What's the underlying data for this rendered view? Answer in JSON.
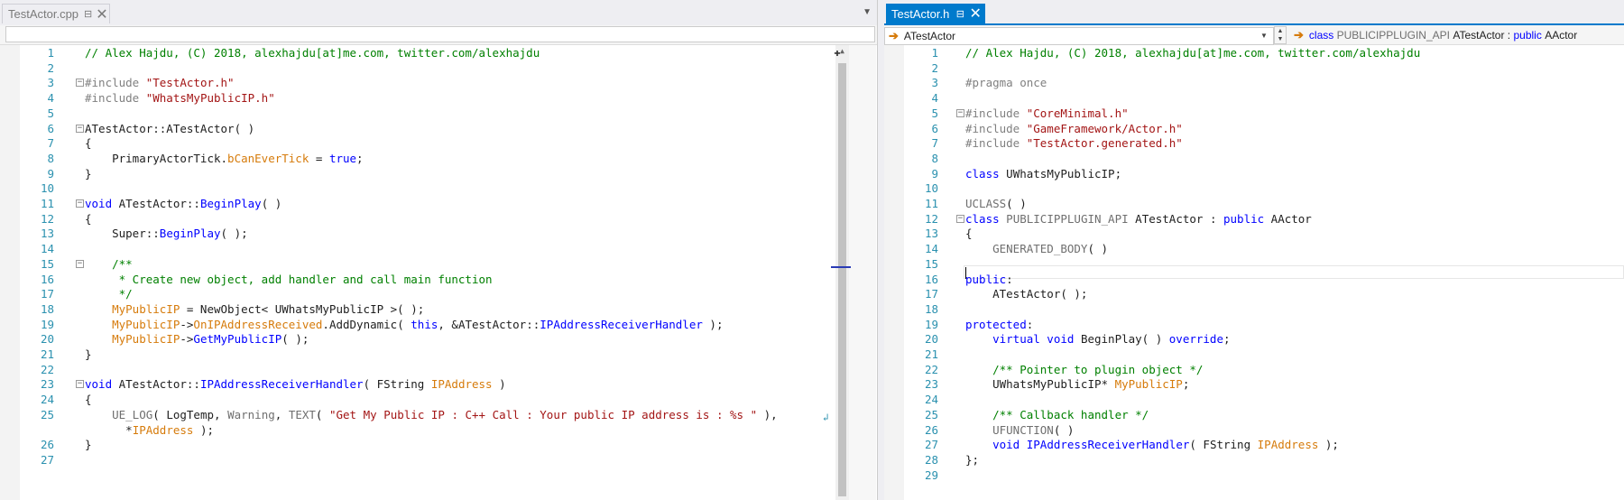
{
  "left_pane": {
    "tab": {
      "label": "TestActor.cpp"
    },
    "nav": {
      "value": ""
    },
    "lines": [
      {
        "n": "1",
        "tokens": [
          [
            "cm",
            "// Alex Hajdu, (C) 2018, alexhajdu[at]me.com, twitter.com/alexhajdu"
          ]
        ]
      },
      {
        "n": "2",
        "tokens": []
      },
      {
        "n": "3",
        "fold": true,
        "tokens": [
          [
            "pp",
            "#include "
          ],
          [
            "st",
            "\"TestActor.h\""
          ]
        ]
      },
      {
        "n": "4",
        "tokens": [
          [
            "pp",
            "#include "
          ],
          [
            "st",
            "\"WhatsMyPublicIP.h\""
          ]
        ]
      },
      {
        "n": "5",
        "tokens": []
      },
      {
        "n": "6",
        "fold": true,
        "tokens": [
          [
            "ty",
            "ATestActor::ATestActor( )"
          ]
        ]
      },
      {
        "n": "7",
        "tokens": [
          [
            "ty",
            "{"
          ]
        ]
      },
      {
        "n": "8",
        "tokens": [
          [
            "ty",
            "    PrimaryActorTick."
          ],
          [
            "mem",
            "bCanEverTick"
          ],
          [
            "ty",
            " = "
          ],
          [
            "kw",
            "true"
          ],
          [
            "ty",
            ";"
          ]
        ]
      },
      {
        "n": "9",
        "tokens": [
          [
            "ty",
            "}"
          ]
        ]
      },
      {
        "n": "10",
        "tokens": []
      },
      {
        "n": "11",
        "fold": true,
        "tokens": [
          [
            "kw",
            "void"
          ],
          [
            "ty",
            " ATestActor::"
          ],
          [
            "fn",
            "BeginPlay"
          ],
          [
            "ty",
            "( )"
          ]
        ]
      },
      {
        "n": "12",
        "tokens": [
          [
            "ty",
            "{"
          ]
        ]
      },
      {
        "n": "13",
        "tokens": [
          [
            "ty",
            "    Super::"
          ],
          [
            "fn",
            "BeginPlay"
          ],
          [
            "ty",
            "( );"
          ]
        ]
      },
      {
        "n": "14",
        "tokens": []
      },
      {
        "n": "15",
        "fold": true,
        "tokens": [
          [
            "cm",
            "    /**"
          ]
        ]
      },
      {
        "n": "16",
        "tokens": [
          [
            "cm",
            "     * Create new object, add handler and call main function"
          ]
        ]
      },
      {
        "n": "17",
        "tokens": [
          [
            "cm",
            "     */"
          ]
        ]
      },
      {
        "n": "18",
        "tokens": [
          [
            "mem",
            "    MyPublicIP"
          ],
          [
            "ty",
            " = NewObject< UWhatsMyPublicIP >( );"
          ]
        ]
      },
      {
        "n": "19",
        "tokens": [
          [
            "mem",
            "    MyPublicIP"
          ],
          [
            "ty",
            "->"
          ],
          [
            "mem",
            "OnIPAddressReceived"
          ],
          [
            "ty",
            ".AddDynamic( "
          ],
          [
            "kw",
            "this"
          ],
          [
            "ty",
            ", &ATestActor::"
          ],
          [
            "fn",
            "IPAddressReceiverHandler"
          ],
          [
            "ty",
            " );"
          ]
        ]
      },
      {
        "n": "20",
        "tokens": [
          [
            "mem",
            "    MyPublicIP"
          ],
          [
            "ty",
            "->"
          ],
          [
            "fn",
            "GetMyPublicIP"
          ],
          [
            "ty",
            "( );"
          ]
        ]
      },
      {
        "n": "21",
        "tokens": [
          [
            "ty",
            "}"
          ]
        ]
      },
      {
        "n": "22",
        "tokens": []
      },
      {
        "n": "23",
        "fold": true,
        "tokens": [
          [
            "kw",
            "void"
          ],
          [
            "ty",
            " ATestActor::"
          ],
          [
            "fn",
            "IPAddressReceiverHandler"
          ],
          [
            "ty",
            "( FString "
          ],
          [
            "par",
            "IPAddress"
          ],
          [
            "ty",
            " )"
          ]
        ]
      },
      {
        "n": "24",
        "tokens": [
          [
            "ty",
            "{"
          ]
        ]
      },
      {
        "n": "25",
        "tokens": [
          [
            "mac",
            "    UE_LOG"
          ],
          [
            "ty",
            "( LogTemp, "
          ],
          [
            "mac",
            "Warning"
          ],
          [
            "ty",
            ", "
          ],
          [
            "mac",
            "TEXT"
          ],
          [
            "ty",
            "( "
          ],
          [
            "st",
            "\"Get My Public IP : C++ Call : Your public IP address is : %s \""
          ],
          [
            "ty",
            " ),"
          ]
        ]
      },
      {
        "n": "",
        "tokens": [
          [
            "ty",
            "      *"
          ],
          [
            "par",
            "IPAddress"
          ],
          [
            "ty",
            " );"
          ]
        ]
      },
      {
        "n": "26",
        "tokens": [
          [
            "ty",
            "}"
          ]
        ]
      },
      {
        "n": "27",
        "tokens": []
      }
    ]
  },
  "right_pane": {
    "tab": {
      "label": "TestActor.h"
    },
    "nav": {
      "scope": "ATestActor",
      "member_prefix": "class",
      "member": "PUBLICIPPLUGIN_API",
      "member_class": "ATestActor",
      "member_sep": " : ",
      "member_kw": "public",
      "member_base": "AActor"
    },
    "lines": [
      {
        "n": "1",
        "tokens": [
          [
            "cm",
            "// Alex Hajdu, (C) 2018, alexhajdu[at]me.com, twitter.com/alexhajdu"
          ]
        ]
      },
      {
        "n": "2",
        "tokens": []
      },
      {
        "n": "3",
        "tokens": [
          [
            "pp",
            "#pragma once"
          ]
        ]
      },
      {
        "n": "4",
        "tokens": []
      },
      {
        "n": "5",
        "fold": true,
        "tokens": [
          [
            "pp",
            "#include "
          ],
          [
            "st",
            "\"CoreMinimal.h\""
          ]
        ]
      },
      {
        "n": "6",
        "tokens": [
          [
            "pp",
            "#include "
          ],
          [
            "st",
            "\"GameFramework/Actor.h\""
          ]
        ]
      },
      {
        "n": "7",
        "tokens": [
          [
            "pp",
            "#include "
          ],
          [
            "st",
            "\"TestActor.generated.h\""
          ]
        ]
      },
      {
        "n": "8",
        "tokens": []
      },
      {
        "n": "9",
        "tokens": [
          [
            "kw",
            "class"
          ],
          [
            "ty",
            " UWhatsMyPublicIP;"
          ]
        ]
      },
      {
        "n": "10",
        "tokens": []
      },
      {
        "n": "11",
        "tokens": [
          [
            "mac",
            "UCLASS"
          ],
          [
            "ty",
            "( )"
          ]
        ]
      },
      {
        "n": "12",
        "fold": true,
        "tokens": [
          [
            "kw",
            "class"
          ],
          [
            "mac",
            " PUBLICIPPLUGIN_API"
          ],
          [
            "ty",
            " ATestActor : "
          ],
          [
            "kw",
            "public"
          ],
          [
            "ty",
            " AActor"
          ]
        ]
      },
      {
        "n": "13",
        "tokens": [
          [
            "ty",
            "{"
          ]
        ]
      },
      {
        "n": "14",
        "tokens": [
          [
            "mac",
            "    GENERATED_BODY"
          ],
          [
            "ty",
            "( )"
          ]
        ]
      },
      {
        "n": "15",
        "tokens": []
      },
      {
        "n": "16",
        "tokens": [
          [
            "kw",
            "public"
          ],
          [
            "ty",
            ":"
          ]
        ]
      },
      {
        "n": "17",
        "tokens": [
          [
            "ty",
            "    ATestActor( );"
          ]
        ]
      },
      {
        "n": "18",
        "tokens": []
      },
      {
        "n": "19",
        "tokens": [
          [
            "kw",
            "protected"
          ],
          [
            "ty",
            ":"
          ]
        ]
      },
      {
        "n": "20",
        "tokens": [
          [
            "kw",
            "    virtual void"
          ],
          [
            "ty",
            " BeginPlay( ) "
          ],
          [
            "kw",
            "override"
          ],
          [
            "ty",
            ";"
          ]
        ]
      },
      {
        "n": "21",
        "tokens": []
      },
      {
        "n": "22",
        "tokens": [
          [
            "cm",
            "    /** Pointer to plugin object */"
          ]
        ]
      },
      {
        "n": "23",
        "tokens": [
          [
            "ty",
            "    UWhatsMyPublicIP* "
          ],
          [
            "mem",
            "MyPublicIP"
          ],
          [
            "ty",
            ";"
          ]
        ]
      },
      {
        "n": "24",
        "tokens": []
      },
      {
        "n": "25",
        "tokens": [
          [
            "cm",
            "    /** Callback handler */"
          ]
        ]
      },
      {
        "n": "26",
        "tokens": [
          [
            "mac",
            "    UFUNCTION"
          ],
          [
            "ty",
            "( )"
          ]
        ]
      },
      {
        "n": "27",
        "tokens": [
          [
            "kw",
            "    void"
          ],
          [
            "ty",
            " "
          ],
          [
            "fn",
            "IPAddressReceiverHandler"
          ],
          [
            "ty",
            "( FString "
          ],
          [
            "par",
            "IPAddress"
          ],
          [
            "ty",
            " );"
          ]
        ]
      },
      {
        "n": "28",
        "tokens": [
          [
            "ty",
            "};"
          ]
        ]
      },
      {
        "n": "29",
        "tokens": []
      }
    ]
  },
  "colors": {
    "accent": "#007acc",
    "keyword": "#0000ff",
    "comment": "#008000",
    "string": "#a31515",
    "line_number": "#2b91af",
    "member": "#d67b0b"
  },
  "icons": {
    "pin": "pin-icon",
    "close": "close-icon",
    "nav": "navigate-arrow-icon"
  }
}
